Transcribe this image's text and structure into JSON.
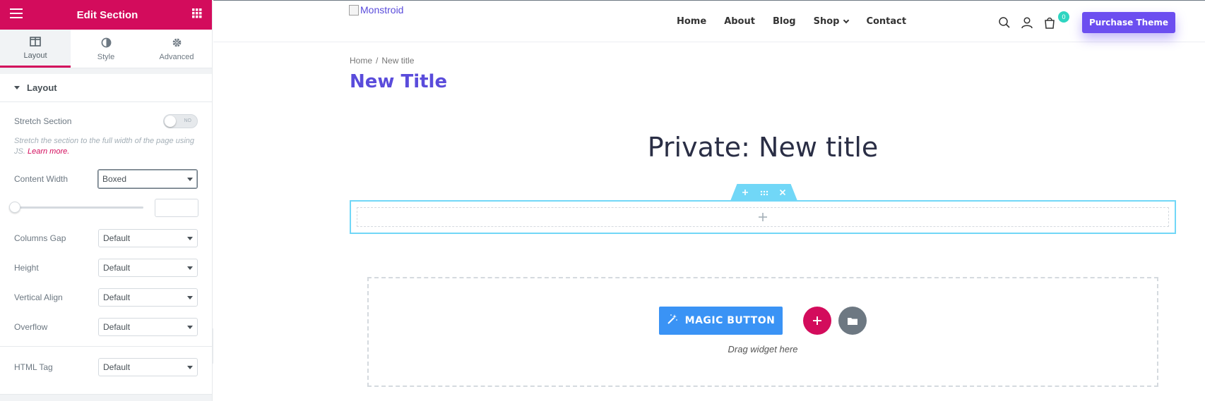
{
  "sidebar": {
    "title": "Edit Section",
    "tabs": [
      {
        "label": "Layout",
        "icon": "columns-icon"
      },
      {
        "label": "Style",
        "icon": "half-circle-icon"
      },
      {
        "label": "Advanced",
        "icon": "gear-icon"
      }
    ],
    "section_label": "Layout",
    "stretch_label": "Stretch Section",
    "stretch_toggle": "NO",
    "stretch_desc": "Stretch the section to the full width of the page using JS.",
    "learn_more": "Learn more.",
    "content_width_label": "Content Width",
    "content_width_value": "Boxed",
    "columns_gap_label": "Columns Gap",
    "columns_gap_value": "Default",
    "height_label": "Height",
    "height_value": "Default",
    "vertical_align_label": "Vertical Align",
    "vertical_align_value": "Default",
    "overflow_label": "Overflow",
    "overflow_value": "Default",
    "html_tag_label": "HTML Tag",
    "html_tag_value": "Default"
  },
  "site": {
    "logo_alt": "Monstroid",
    "nav": [
      "Home",
      "About",
      "Blog",
      "Shop",
      "Contact"
    ],
    "cart_count": "0",
    "purchase_label": "Purchase Theme",
    "breadcrumb_home": "Home",
    "breadcrumb_sep": "/",
    "breadcrumb_current": "New title",
    "page_title": "New Title",
    "private_title": "Private: New title",
    "magic_button": "MAGIC BUTTON",
    "drag_text": "Drag widget here"
  },
  "colors": {
    "accent": "#d30c5c",
    "brand": "#5a4cdb",
    "section_highlight": "#71d7f7",
    "magic_button": "#3a93f5"
  }
}
